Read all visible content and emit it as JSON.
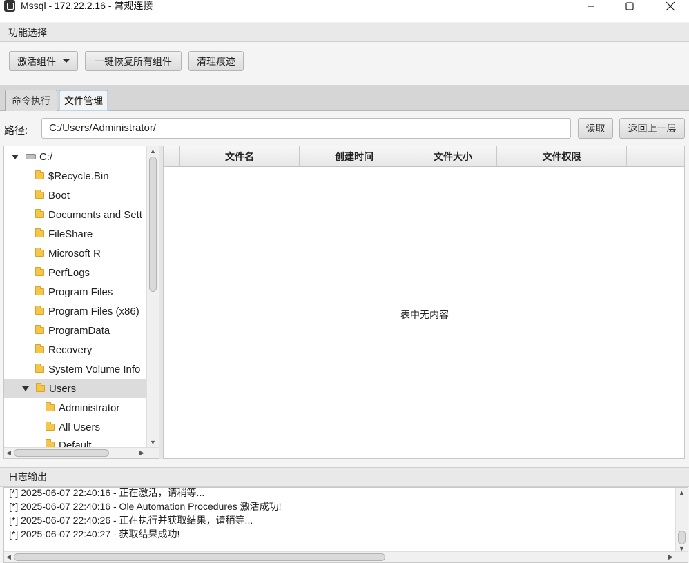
{
  "window": {
    "title": "Mssql - 172.22.2.16 - 常规连接"
  },
  "function_section": {
    "header": "功能选择",
    "activate_button": "激活组件",
    "restore_button": "一键恢复所有组件",
    "clean_button": "清理痕迹"
  },
  "tabs": [
    {
      "label": "命令执行",
      "active": false
    },
    {
      "label": "文件管理",
      "active": true
    }
  ],
  "path_bar": {
    "label": "路径:",
    "value": "C:/Users/Administrator/",
    "read_button": "读取",
    "up_button": "返回上一层"
  },
  "tree": {
    "root": "C:/",
    "items": [
      {
        "label": "$Recycle.Bin"
      },
      {
        "label": "Boot"
      },
      {
        "label": "Documents and Sett"
      },
      {
        "label": "FileShare"
      },
      {
        "label": "Microsoft R"
      },
      {
        "label": "PerfLogs"
      },
      {
        "label": "Program Files"
      },
      {
        "label": "Program Files (x86)"
      },
      {
        "label": "ProgramData"
      },
      {
        "label": "Recovery"
      },
      {
        "label": "System Volume Info"
      },
      {
        "label": "Users",
        "expanded": true,
        "selected": true
      }
    ],
    "children": [
      {
        "label": "Administrator"
      },
      {
        "label": "All Users"
      },
      {
        "label": "Default"
      }
    ]
  },
  "file_table": {
    "columns": [
      "文件名",
      "创建时间",
      "文件大小",
      "文件权限"
    ],
    "empty_message": "表中无内容"
  },
  "log": {
    "header": "日志输出",
    "lines": [
      "[*] 2025-06-07 22:40:16 - 正在激活，请稍等...",
      "[*] 2025-06-07 22:40:16 - Ole Automation Procedures 激活成功!",
      "[*] 2025-06-07 22:40:26 - 正在执行并获取结果，请稍等...",
      "[*] 2025-06-07 22:40:27 - 获取结果成功!"
    ]
  }
}
